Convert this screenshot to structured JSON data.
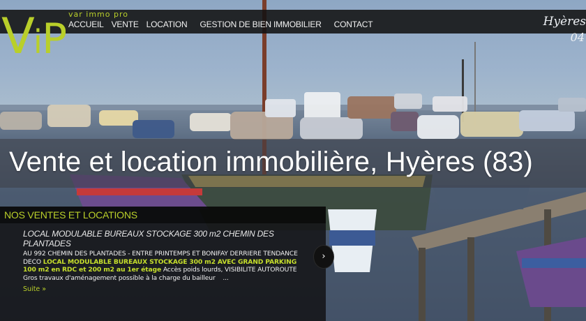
{
  "brand": {
    "logo_text": "ViP",
    "subtitle": "var immo pro",
    "accent_color": "#b9cf2a"
  },
  "nav": {
    "items": [
      {
        "label": "ACCUEIL"
      },
      {
        "label": "VENTE"
      },
      {
        "label": "LOCATION"
      },
      {
        "label": "GESTION DE BIEN IMMOBILIER"
      },
      {
        "label": "CONTACT"
      }
    ]
  },
  "city_logo": {
    "name": "Hyères",
    "number": "04"
  },
  "hero": {
    "title": "Vente et location immobilière, Hyères (83)"
  },
  "listings_panel": {
    "heading": "NOS VENTES ET LOCATIONS",
    "next_icon": "chevron-right-icon",
    "listing": {
      "title": "LOCAL MODULABLE BUREAUX STOCKAGE 300 m2 CHEMIN DES PLANTADES",
      "desc_part1": "AU 992 CHEMIN DES PLANTADES - ENTRE PRINTEMPS ET BONIFAY DERRIERE TENDANCE DECO ",
      "desc_highlight": "LOCAL MODULABLE BUREAUX STOCKAGE 300 m2 AVEC GRAND PARKING 100 m2 en RDC et 200 m2 au 1er étage",
      "desc_part2": " Accès poids lourds, VISIBILITE AUTOROUTE Gros travaux d'aménagement possible à la charge du bailleur",
      "ellipsis": "...",
      "more_link": "Suite »"
    }
  }
}
